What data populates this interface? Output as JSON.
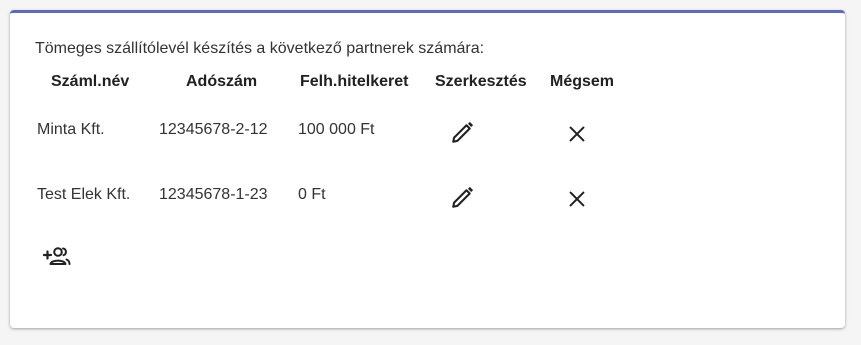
{
  "intro_text": "Tömeges szállítólevél készítés a következő partnerek számára:",
  "columns": {
    "name": "Száml.név",
    "tax_number": "Adószám",
    "credit_limit": "Felh.hitelkeret",
    "edit": "Szerkesztés",
    "cancel": "Mégsem"
  },
  "rows": [
    {
      "name": "Minta Kft.",
      "tax_number": "12345678-2-12",
      "credit_limit": "100 000 Ft"
    },
    {
      "name": "Test Elek Kft.",
      "tax_number": "12345678-1-23",
      "credit_limit": "0 Ft"
    }
  ],
  "icons": {
    "edit": "pencil-icon",
    "cancel": "close-icon",
    "add": "add-partner-icon"
  },
  "colors": {
    "accent": "#5c6bc0",
    "text": "#333333",
    "header_text": "#212121",
    "icon": "#212121"
  }
}
